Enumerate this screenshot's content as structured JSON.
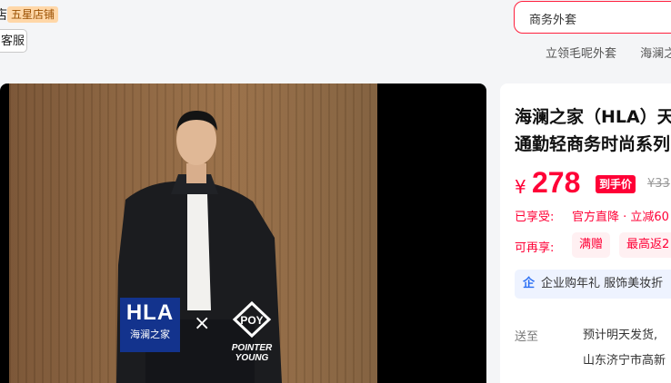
{
  "store": {
    "name_suffix": "店",
    "badge": "五星店铺",
    "service_button": "客服"
  },
  "search": {
    "query": "商务外套",
    "hot_words": [
      "立领毛呢外套",
      "海澜之"
    ]
  },
  "gallery": {
    "brand_logo_main": "HLA",
    "brand_logo_sub": "海澜之家",
    "collab_symbol": "×",
    "collab_brand": "POINTER YOUNG"
  },
  "product": {
    "title_line1": "海澜之家（HLA）天",
    "title_line2": "通勤轻商务时尚系列",
    "currency": "¥",
    "price": "278",
    "price_tag": "到手价",
    "original_price": "¥33",
    "enjoyed_label": "已享受:",
    "enjoyed_text": "官方直降 · 立减60",
    "more_label": "可再享:",
    "chips": [
      "满赠",
      "最高返2"
    ],
    "enterprise_icon": "企",
    "enterprise_text": "企业购年礼 服饰美妆折",
    "ship_label": "送至",
    "ship_line1": "预计明天发货,",
    "ship_line2": "山东济宁市高新"
  },
  "colors": {
    "accent_red": "#ff0036",
    "brand_navy": "#13338d",
    "enterprise_blue": "#2a6ef3"
  }
}
